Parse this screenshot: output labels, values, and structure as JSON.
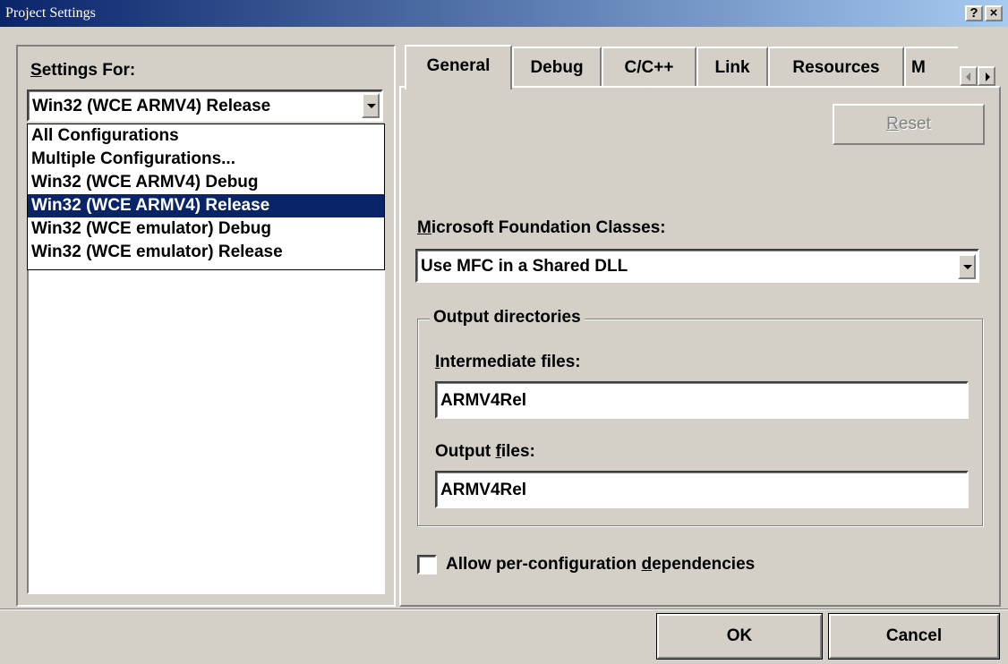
{
  "window": {
    "title": "Project Settings",
    "help_label": "?",
    "close_label": "×"
  },
  "left_panel": {
    "settings_for_prefix": "S",
    "settings_for_rest": "ettings For:",
    "selected_config": "Win32 (WCE ARMV4) Release",
    "configs": [
      "All Configurations",
      "Multiple Configurations...",
      "Win32 (WCE ARMV4) Debug",
      "Win32 (WCE ARMV4) Release",
      "Win32 (WCE emulator) Debug",
      "Win32 (WCE emulator) Release"
    ],
    "highlighted_index": 3
  },
  "tabs": [
    {
      "label": "General"
    },
    {
      "label": "Debug"
    },
    {
      "label": "C/C++"
    },
    {
      "label": "Link"
    },
    {
      "label": "Resources"
    },
    {
      "label": "M"
    }
  ],
  "general": {
    "reset_prefix": "R",
    "reset_rest": "eset",
    "mfc_label_prefix": "M",
    "mfc_label_rest": "icrosoft Foundation Classes:",
    "mfc_value": "Use MFC in a Shared DLL",
    "output_directories": "Output directories",
    "intermediate_prefix": "I",
    "intermediate_rest": "ntermediate files:",
    "intermediate_value": "ARMV4Rel",
    "output_label_pre": "Output ",
    "output_label_ul": "f",
    "output_label_post": "iles:",
    "output_value": "ARMV4Rel",
    "deps_pre": "Allow per-configuration ",
    "deps_ul": "d",
    "deps_post": "ependencies",
    "deps_checked": false
  },
  "footer": {
    "ok_label": "OK",
    "cancel_label": "Cancel"
  }
}
